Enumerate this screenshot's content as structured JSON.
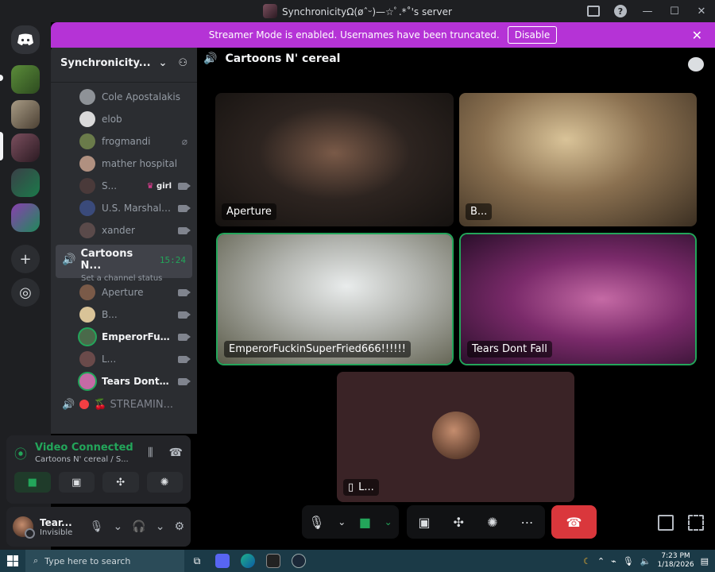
{
  "window": {
    "title": "SynchronicityΩ(øˆᵕ)—☆ﾟ.*˚'s server"
  },
  "banner": {
    "text": "Streamer Mode is enabled. Usernames have been truncated.",
    "disable_label": "Disable"
  },
  "guild": {
    "name": "Synchronicity..."
  },
  "members_top": [
    {
      "name": "Cole Apostalakis",
      "icon": "none"
    },
    {
      "name": "elob",
      "icon": "none"
    },
    {
      "name": "frogmandi",
      "icon": "mic-muted-icon"
    },
    {
      "name": "mather hospital",
      "icon": "none"
    },
    {
      "name": "S...",
      "tag": "girl",
      "icon": "camera-icon"
    },
    {
      "name": "U.S. Marshal ...",
      "icon": "camera-icon"
    },
    {
      "name": "xander",
      "icon": "camera-icon"
    }
  ],
  "active_channel": {
    "name": "Cartoons N...",
    "time": "15:24",
    "status": "Set a channel status"
  },
  "members_active": [
    {
      "name": "Aperture",
      "icon": "camera-icon"
    },
    {
      "name": "B...",
      "icon": "camera-icon"
    },
    {
      "name": "EmperorFuck...",
      "icon": "camera-icon"
    },
    {
      "name": "L...",
      "icon": "camera-icon"
    },
    {
      "name": "Tears Dont Fall",
      "icon": "camera-icon"
    }
  ],
  "other_channel": {
    "name": "🍒 STREAMIN..."
  },
  "voice": {
    "title": "Video Connected",
    "subtitle": "Cartoons N' cereal / S..."
  },
  "user": {
    "name": "Tear...",
    "status": "Invisible"
  },
  "header": {
    "channel": "Cartoons N' cereal"
  },
  "tiles": [
    {
      "label": "Aperture",
      "speaking": false
    },
    {
      "label": "B...",
      "speaking": false
    },
    {
      "label": "EmperorFuckinSuperFried666!!!!!!",
      "speaking": true
    },
    {
      "label": "Tears Dont Fall",
      "speaking": true
    },
    {
      "label": "L...",
      "speaking": false
    }
  ],
  "taskbar": {
    "search_placeholder": "Type here to search",
    "time": "7:23 PM",
    "date": "1/18/2026"
  },
  "colors": {
    "accent_green": "#23a55a",
    "banner": "#b533d6",
    "hangup": "#da373c"
  }
}
